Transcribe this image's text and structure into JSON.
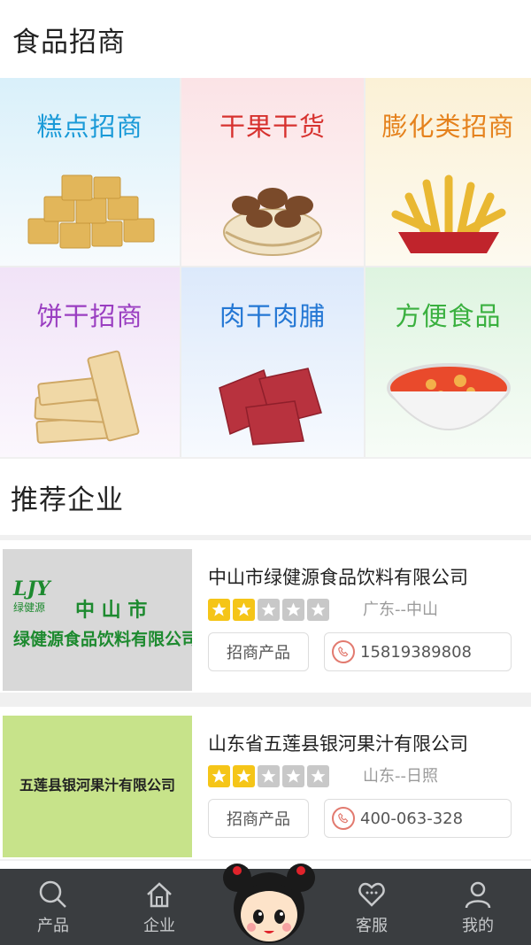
{
  "sections": {
    "food": {
      "title": "食品招商"
    },
    "recommended": {
      "title": "推荐企业"
    }
  },
  "categories": [
    {
      "label": "糕点招商",
      "color": "#1a9ad8",
      "icon": "cake-cubes"
    },
    {
      "label": "干果干货",
      "color": "#d7322f",
      "icon": "pecan-basket"
    },
    {
      "label": "膨化类招商",
      "color": "#e5821d",
      "icon": "fries"
    },
    {
      "label": "饼干招商",
      "color": "#9a3ec1",
      "icon": "crackers"
    },
    {
      "label": "肉干肉脯",
      "color": "#2477d4",
      "icon": "jerky"
    },
    {
      "label": "方便食品",
      "color": "#3ab03f",
      "icon": "noodle-bowl"
    }
  ],
  "companies": [
    {
      "name": "中山市绿健源食品饮料有限公司",
      "rating": 2,
      "max_rating": 5,
      "region": "广东--中山",
      "products_label": "招商产品",
      "phone": "15819389808",
      "logo": {
        "mark": "LJY",
        "brand": "绿健源",
        "line1": "中 山 市",
        "line2": "绿健源食品饮料有限公司",
        "bg": "#d8d8d8",
        "color": "#1d8a2f"
      }
    },
    {
      "name": "山东省五莲县银河果汁有限公司",
      "rating": 2,
      "max_rating": 5,
      "region": "山东--日照",
      "products_label": "招商产品",
      "phone": "400-063-328",
      "logo": {
        "line1": "五莲县银河果汁有限公司",
        "bg": "#c7e38a",
        "color": "#222222"
      }
    }
  ],
  "tabbar": {
    "items": [
      {
        "label": "产品",
        "icon": "search-icon"
      },
      {
        "label": "企业",
        "icon": "home-icon"
      },
      {
        "label": "",
        "icon": "mascot"
      },
      {
        "label": "客服",
        "icon": "heart-chat-icon"
      },
      {
        "label": "我的",
        "icon": "person-icon"
      }
    ]
  },
  "colors": {
    "star_on": "#f5c518",
    "star_off": "#c8c8c8",
    "tabbar_bg": "#3a3d40",
    "phone_icon": "#e27a6f"
  }
}
